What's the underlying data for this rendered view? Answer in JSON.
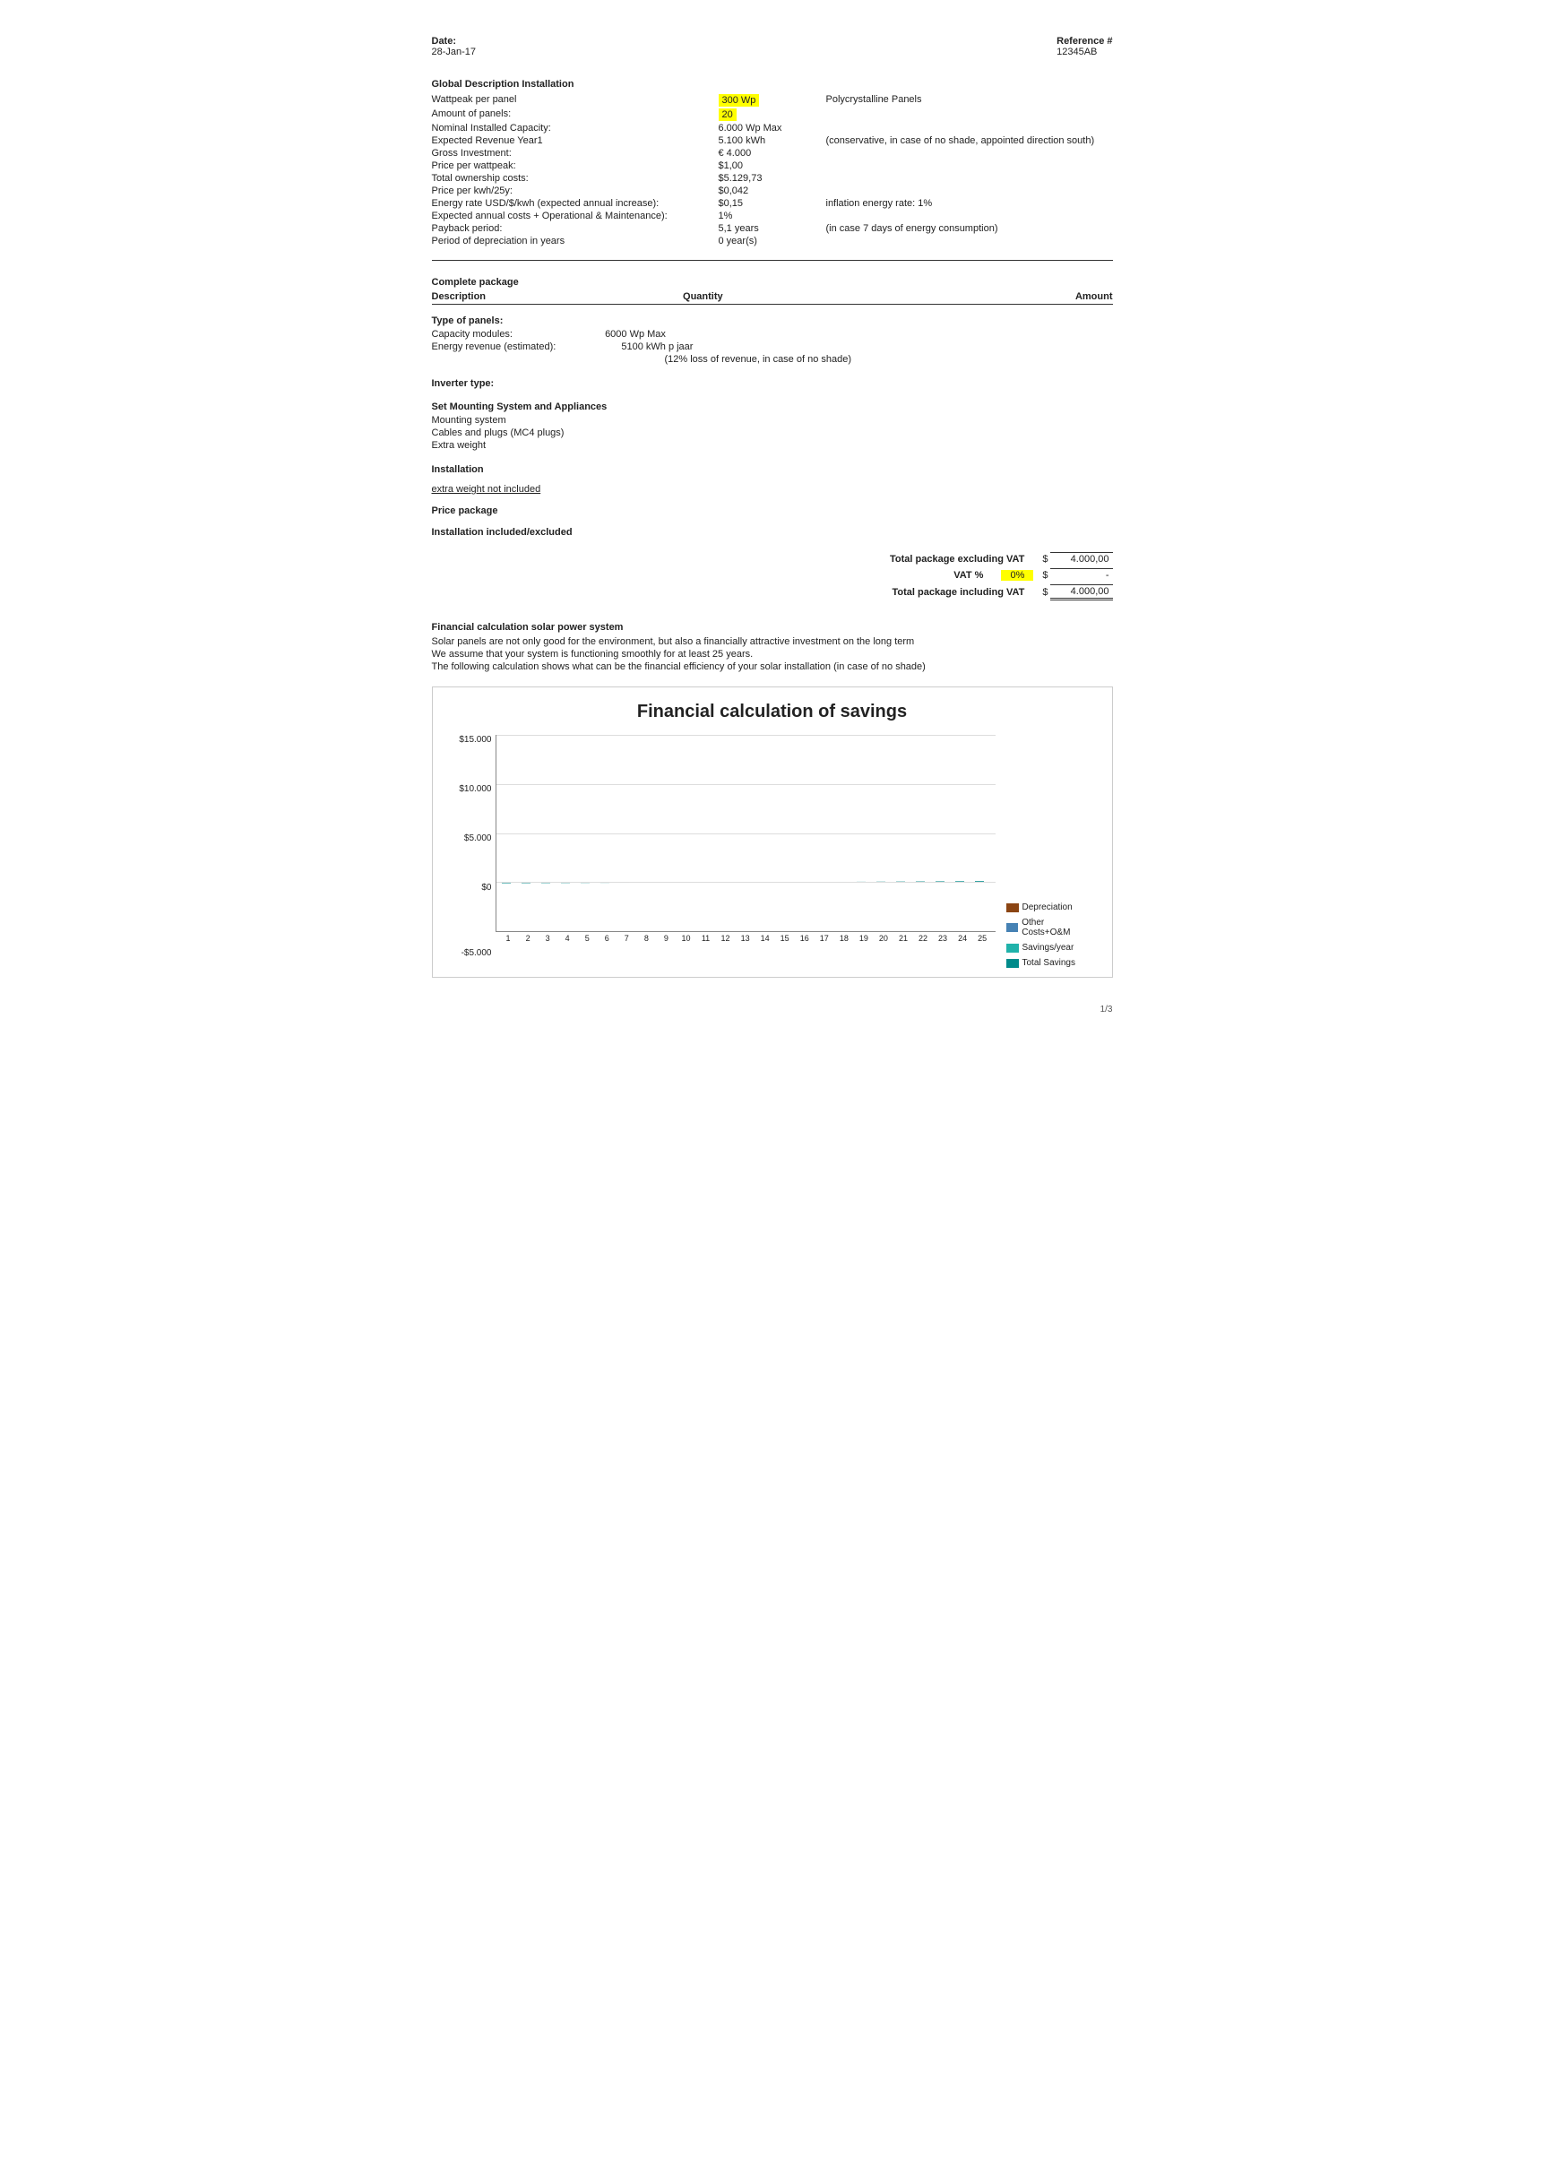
{
  "header": {
    "date_label": "Date:",
    "date_value": "28-Jan-17",
    "reference_label": "Reference #",
    "reference_value": "12345AB"
  },
  "global_description": {
    "title": "Global Description Installation",
    "rows": [
      {
        "label": "Wattpeak per panel",
        "value": "300 Wp",
        "extra": "Polycrystalline Panels",
        "highlight": true
      },
      {
        "label": "Amount of panels:",
        "value": "20",
        "extra": "",
        "highlight": true
      },
      {
        "label": "Nominal Installed Capacity:",
        "value": "6.000 Wp Max",
        "extra": ""
      },
      {
        "label": "Expected Revenue Year1",
        "value": "5.100 kWh",
        "extra": "(conservative, in case of no shade, appointed direction south)"
      },
      {
        "label": "Gross Investment:",
        "value": "€ 4.000",
        "extra": ""
      },
      {
        "label": "Price per wattpeak:",
        "value": "$1,00",
        "extra": ""
      },
      {
        "label": "Total ownership costs:",
        "value": "$5.129,73",
        "extra": ""
      },
      {
        "label": "Price per kwh/25y:",
        "value": "$0,042",
        "extra": ""
      },
      {
        "label": "Energy rate USD/$/kwh (expected annual increase):",
        "value": "$0,15",
        "extra": "inflation energy rate:   1%"
      },
      {
        "label": "Expected annual costs + Operational & Maintenance):",
        "value": "1%",
        "extra": ""
      },
      {
        "label": "Payback period:",
        "value": "5,1 years",
        "extra": "(in case 7 days of energy consumption)"
      },
      {
        "label": "Period of depreciation in years",
        "value": "0 year(s)",
        "extra": ""
      }
    ]
  },
  "complete_package": {
    "title": "Complete package",
    "col_description": "Description",
    "col_quantity": "Quantity",
    "col_amount": "Amount",
    "type_of_panels": {
      "label": "Type of panels:",
      "items": [
        {
          "label": "Capacity modules:",
          "value": "6000 Wp Max"
        },
        {
          "label": "Energy revenue (estimated):",
          "value": "5100 kWh p jaar"
        },
        {
          "label": "",
          "value": "(12% loss of revenue, in case of no shade)"
        }
      ]
    },
    "inverter_type": {
      "label": "Inverter type:"
    },
    "mounting": {
      "label": "Set Mounting System and Appliances",
      "items": [
        "Mounting system",
        "Cables and plugs (MC4 plugs)",
        "Extra weight"
      ]
    },
    "installation": {
      "label": "Installation"
    },
    "extra_weight_note": "extra weight not included",
    "price_package_label": "Price package",
    "installation_label": "Installation included/excluded",
    "total_excl_vat": "Total package excluding VAT",
    "vat_label": "VAT %",
    "vat_value": "0%",
    "total_incl_vat": "Total package including VAT",
    "amount_excl": "4.000,00",
    "amount_vat": "-",
    "amount_incl": "4.000,00"
  },
  "financial": {
    "title": "Financial calculation solar power system",
    "desc1": "Solar panels are not only good for the environment, but also a financially attractive investment on the long term",
    "desc2": "We assume that your system is functioning smoothly for at least 25 years.",
    "desc3": "The following calculation shows what can be the financial efficiency of your solar installation (in case of no shade)",
    "chart_title": "Financial calculation of savings",
    "y_labels": [
      "$15.000",
      "$10.000",
      "$5.000",
      "$0",
      "-$5.000"
    ],
    "x_labels": [
      "1",
      "2",
      "3",
      "4",
      "5",
      "6",
      "7",
      "8",
      "9",
      "10",
      "11",
      "12",
      "13",
      "14",
      "15",
      "16",
      "17",
      "18",
      "19",
      "20",
      "21",
      "22",
      "23",
      "24",
      "25"
    ],
    "legend": [
      {
        "label": "Depreciation",
        "color": "#8B4513"
      },
      {
        "label": "Other Costs+O&M",
        "color": "#4682B4"
      },
      {
        "label": "Savings/year",
        "color": "#20B2AA"
      },
      {
        "label": "Total Savings",
        "color": "#008B8B"
      }
    ],
    "bars": [
      {
        "depreciation": 15,
        "other": 5,
        "savings": 8,
        "total": -50
      },
      {
        "depreciation": 15,
        "other": 5,
        "savings": 8,
        "total": -42
      },
      {
        "depreciation": 15,
        "other": 5,
        "savings": 8,
        "total": -34
      },
      {
        "depreciation": 0,
        "other": 5,
        "savings": 10,
        "total": -26
      },
      {
        "depreciation": 0,
        "other": 5,
        "savings": 10,
        "total": -18
      },
      {
        "depreciation": 0,
        "other": 5,
        "savings": 10,
        "total": -10
      },
      {
        "depreciation": 0,
        "other": 5,
        "savings": 10,
        "total": -2
      },
      {
        "depreciation": 0,
        "other": 5,
        "savings": 11,
        "total": 6
      },
      {
        "depreciation": 0,
        "other": 5,
        "savings": 11,
        "total": 14
      },
      {
        "depreciation": 0,
        "other": 5,
        "savings": 11,
        "total": 22
      },
      {
        "depreciation": 0,
        "other": 5,
        "savings": 11,
        "total": 30
      },
      {
        "depreciation": 0,
        "other": 5,
        "savings": 12,
        "total": 38
      },
      {
        "depreciation": 0,
        "other": 5,
        "savings": 12,
        "total": 46
      },
      {
        "depreciation": 0,
        "other": 5,
        "savings": 12,
        "total": 55
      },
      {
        "depreciation": 0,
        "other": 5,
        "savings": 12,
        "total": 64
      },
      {
        "depreciation": 0,
        "other": 5,
        "savings": 13,
        "total": 73
      },
      {
        "depreciation": 0,
        "other": 5,
        "savings": 13,
        "total": 82
      },
      {
        "depreciation": 0,
        "other": 5,
        "savings": 13,
        "total": 91
      },
      {
        "depreciation": 0,
        "other": 5,
        "savings": 14,
        "total": 100
      },
      {
        "depreciation": 0,
        "other": 5,
        "savings": 14,
        "total": 110
      },
      {
        "depreciation": 0,
        "other": 5,
        "savings": 15,
        "total": 120
      },
      {
        "depreciation": 0,
        "other": 5,
        "savings": 15,
        "total": 130
      },
      {
        "depreciation": 0,
        "other": 5,
        "savings": 16,
        "total": 140
      },
      {
        "depreciation": 0,
        "other": 5,
        "savings": 16,
        "total": 151
      },
      {
        "depreciation": 0,
        "other": 5,
        "savings": 17,
        "total": 162
      }
    ]
  },
  "page_number": "1/3"
}
